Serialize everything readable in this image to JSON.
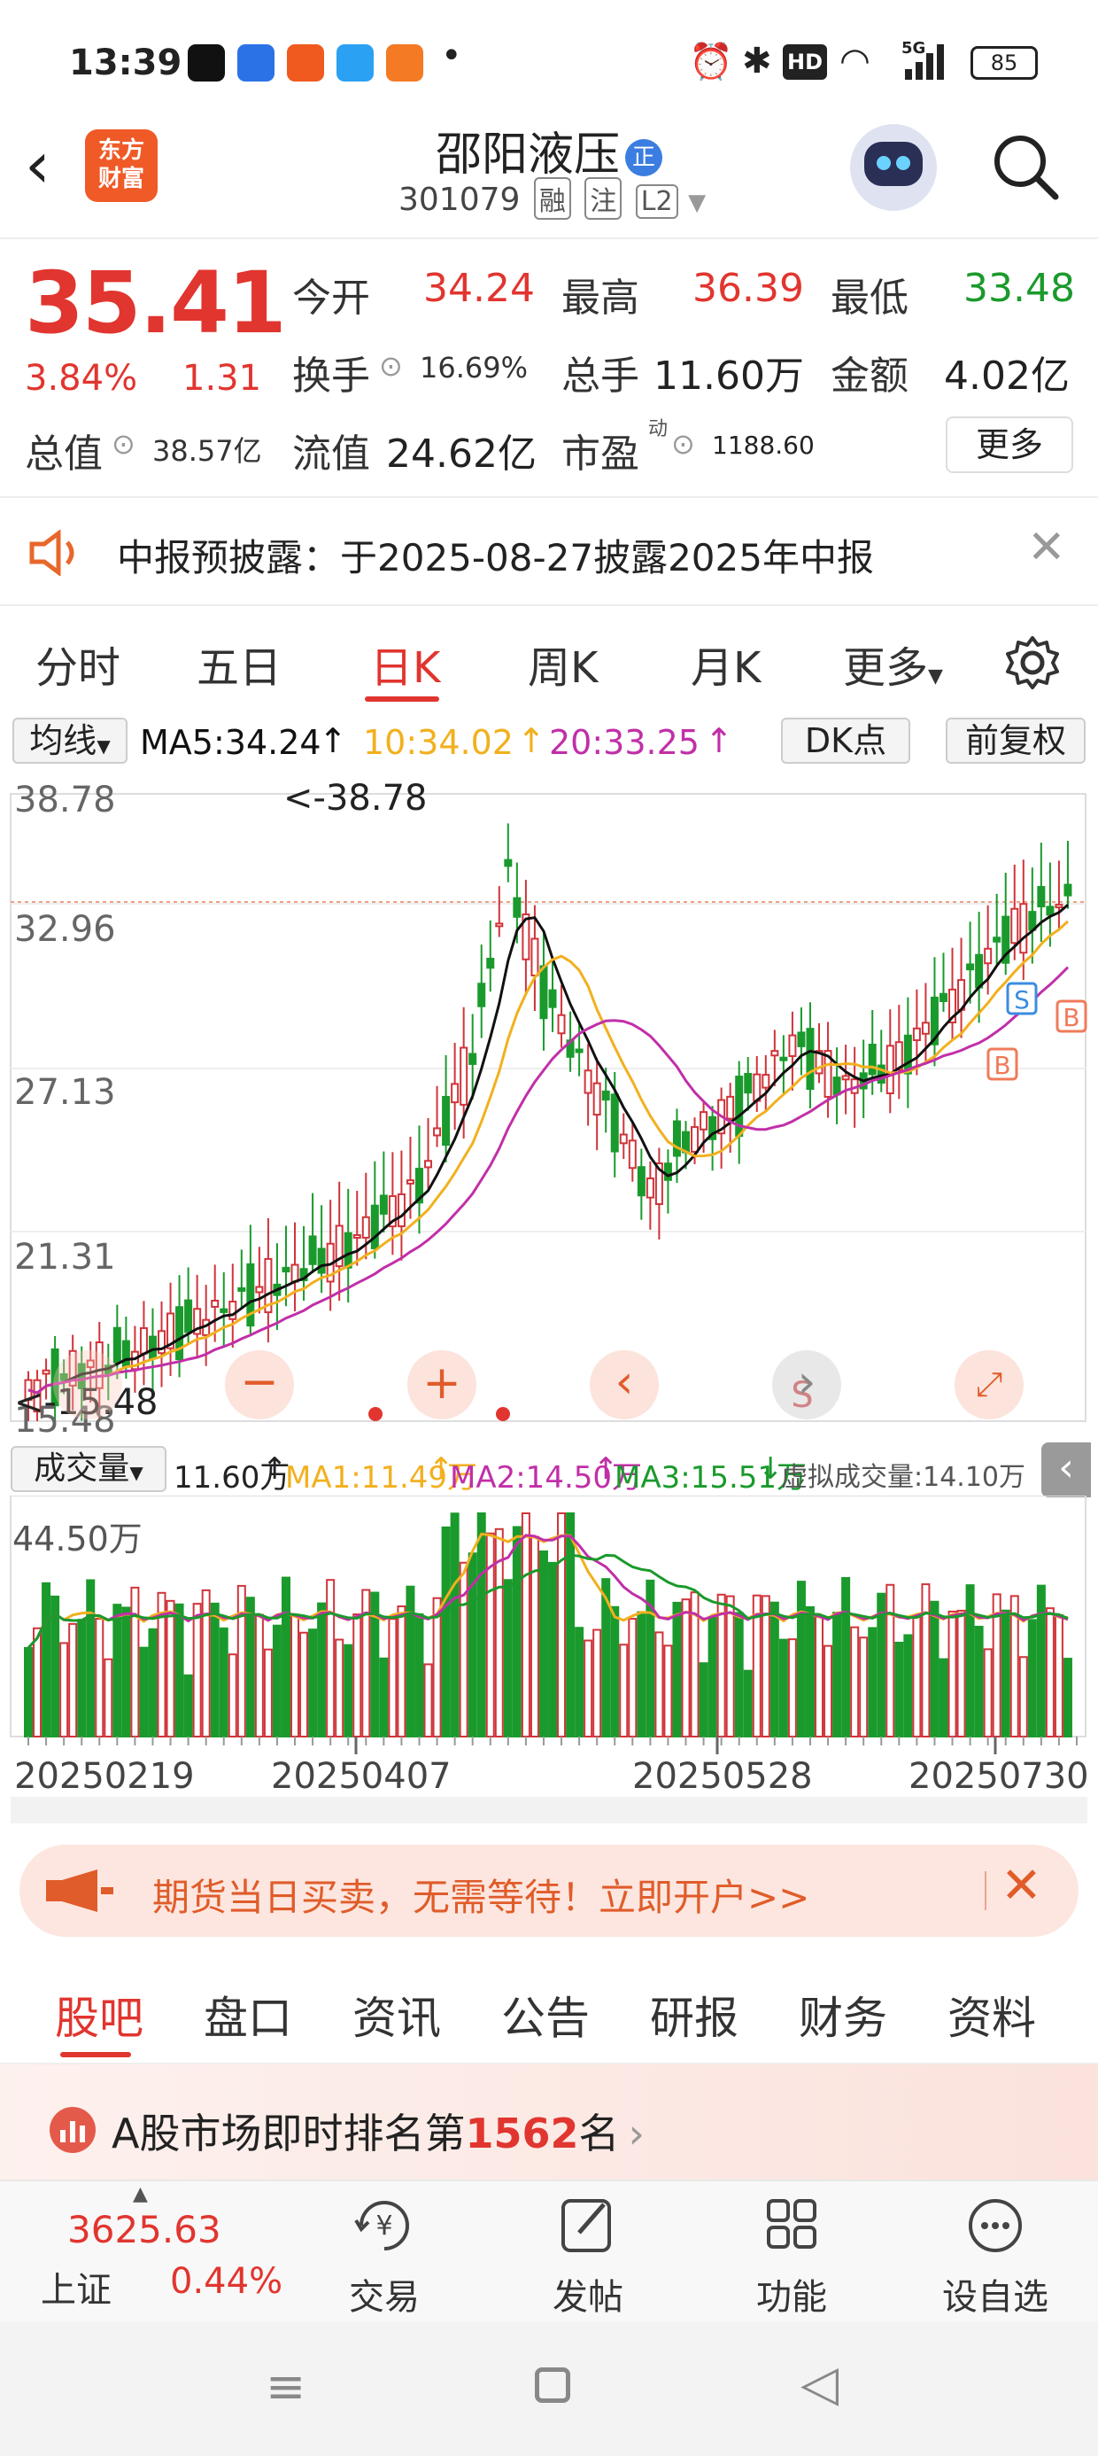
{
  "status_bar": {
    "time": "13:39",
    "network": "5G",
    "battery": "85",
    "icons": [
      "alarm-icon",
      "bluetooth-icon",
      "hd-icon",
      "wifi-icon",
      "signal-icon",
      "battery-icon"
    ]
  },
  "header": {
    "logo_line1": "东方",
    "logo_line2": "财富",
    "stock_name": "邵阳液压",
    "stock_badge": "正",
    "stock_code": "301079",
    "tags": [
      "融",
      "注",
      "L2"
    ]
  },
  "quote": {
    "price": "35.41",
    "change_pct": "3.84%",
    "change_amt": "1.31",
    "open_label": "今开",
    "open": "34.24",
    "high_label": "最高",
    "high": "36.39",
    "low_label": "最低",
    "low": "33.48",
    "turnover_label": "换手",
    "turnover": "16.69%",
    "volume_label": "总手",
    "volume": "11.60万",
    "amount_label": "金额",
    "amount": "4.02亿",
    "mktcap_label": "总值",
    "mktcap": "38.57亿",
    "float_label": "流值",
    "float": "24.62亿",
    "pe_label": "市盈",
    "pe_sup": "动",
    "pe": "1188.60",
    "more_label": "更多"
  },
  "notice": {
    "text": "中报预披露：于2025-08-27披露2025年中报"
  },
  "chart_tabs": [
    {
      "label": "分时",
      "active": false
    },
    {
      "label": "五日",
      "active": false
    },
    {
      "label": "日K",
      "active": true
    },
    {
      "label": "周K",
      "active": false
    },
    {
      "label": "月K",
      "active": false
    },
    {
      "label": "更多",
      "active": false
    }
  ],
  "ma_row": {
    "selector": "均线",
    "ma5": "MA5:34.24",
    "ma10": "10:34.02",
    "ma20": "20:33.25",
    "dk_button": "DK点",
    "adjust_button": "前复权"
  },
  "kline": {
    "y_labels": [
      "38.78",
      "32.96",
      "27.13",
      "21.31",
      "15.48"
    ],
    "max_marker": "<-38.78",
    "min_marker": "<-15.48",
    "signals": [
      "S",
      "B",
      "B",
      "S"
    ],
    "colors": {
      "up": "#d0343a",
      "down": "#1a9a2c",
      "ma5": "#111111",
      "ma10": "#f2b01e",
      "ma20": "#c12fa8"
    }
  },
  "volume_row": {
    "selector": "成交量",
    "vol": "11.60万",
    "ma1": "MA1:11.49万",
    "ma2": "MA2:14.50万",
    "ma3": "MA3:15.51万",
    "virtual": "虚拟成交量:14.10万",
    "y_label": "44.50万"
  },
  "dates": [
    "20250219",
    "20250407",
    "20250528",
    "20250730"
  ],
  "promo": {
    "text": "期货当日买卖，无需等待！立即开户>>"
  },
  "bottom_tabs": [
    {
      "label": "股吧",
      "active": true
    },
    {
      "label": "盘口",
      "active": false
    },
    {
      "label": "资讯",
      "active": false
    },
    {
      "label": "公告",
      "active": false
    },
    {
      "label": "研报",
      "active": false
    },
    {
      "label": "财务",
      "active": false
    },
    {
      "label": "资料",
      "active": false
    }
  ],
  "rank": {
    "prefix": "A股市场即时排名第",
    "number": "1562",
    "suffix": "名"
  },
  "bottom_nav": {
    "index_value": "3625.63",
    "index_name": "上证",
    "index_change": "0.44%",
    "items": [
      "交易",
      "发帖",
      "功能",
      "设自选"
    ]
  },
  "chart_data": {
    "type": "candlestick",
    "y_ticks": [
      38.78,
      32.96,
      27.13,
      21.31,
      15.48
    ],
    "ylim": [
      15.48,
      38.78
    ],
    "x_ticks": [
      "20250219",
      "20250407",
      "20250528",
      "20250730"
    ],
    "highest": 38.78,
    "lowest": 15.48,
    "last_close": 35.41,
    "ma5": 34.24,
    "ma10": 34.02,
    "ma20": 33.25,
    "volume_last": "11.60万",
    "volume_ma": {
      "MA1": "11.49万",
      "MA2": "14.50万",
      "MA3": "15.51万"
    },
    "volume_ymax": "44.50万"
  }
}
